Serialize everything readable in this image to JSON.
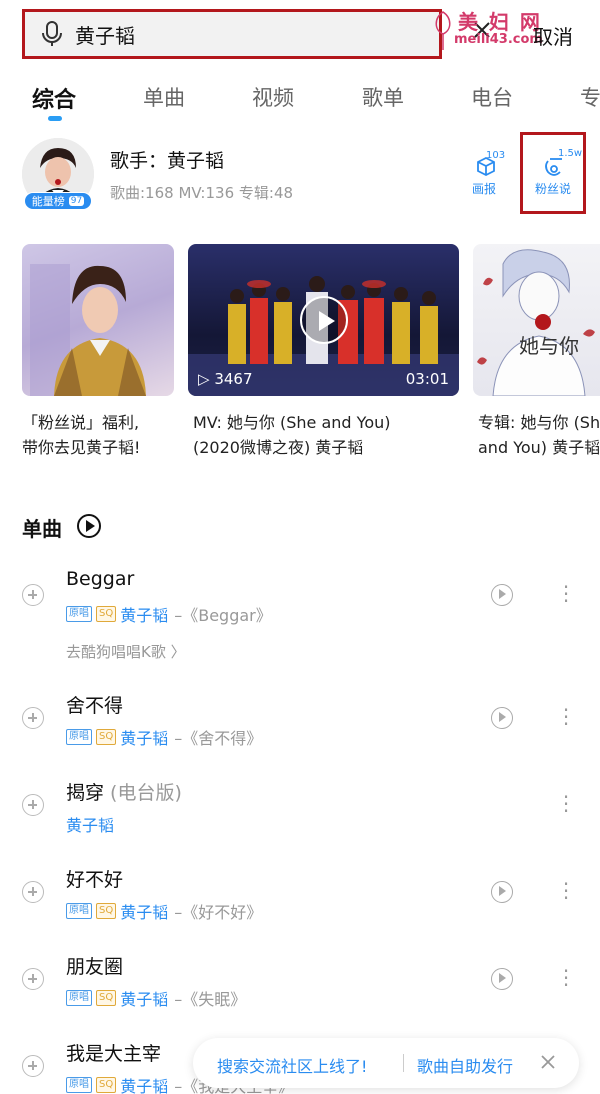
{
  "search": {
    "query": "黄子韬",
    "cancel_label": "取消"
  },
  "watermark": {
    "main": "美 妇 网",
    "sub": "meili43.com"
  },
  "tabs": [
    {
      "label": "综合"
    },
    {
      "label": "单曲"
    },
    {
      "label": "视频"
    },
    {
      "label": "歌单"
    },
    {
      "label": "电台"
    },
    {
      "label": "专"
    }
  ],
  "singer": {
    "name": "歌手：黄子韬",
    "stats": "歌曲:168  MV:136  专辑:48",
    "badge_label": "能量榜",
    "badge_level": "97",
    "poster": {
      "label": "画报",
      "count": "103"
    },
    "fans": {
      "label": "粉丝说",
      "count": "1.5w"
    }
  },
  "cards": [
    {
      "caption_1": "「粉丝说」福利,",
      "caption_2": "带你去见黄子韬!"
    },
    {
      "caption_1": "MV: 她与你 (She and You)",
      "caption_2": "(2020微博之夜) 黄子韬",
      "plays": "3467",
      "duration": "03:01"
    },
    {
      "caption_1": "专辑: 她与你 (Sh",
      "caption_2": "and You) 黄子韬",
      "art_text": "她与你"
    }
  ],
  "section": {
    "title": "单曲"
  },
  "songs": [
    {
      "title": "Beggar",
      "suffix": "",
      "tags": true,
      "artist": "黄子韬",
      "album": "–《Beggar》",
      "extra": "去酷狗唱唱K歌 〉",
      "playable": true
    },
    {
      "title": "舍不得",
      "suffix": "",
      "tags": true,
      "artist": "黄子韬",
      "album": "–《舍不得》",
      "extra": "",
      "playable": true
    },
    {
      "title": "揭穿",
      "suffix": " (电台版)",
      "tags": false,
      "artist": "黄子韬",
      "album": "",
      "extra": "",
      "playable": false
    },
    {
      "title": "好不好",
      "suffix": "",
      "tags": true,
      "artist": "黄子韬",
      "album": "–《好不好》",
      "extra": "",
      "playable": true
    },
    {
      "title": "朋友圈",
      "suffix": "",
      "tags": true,
      "artist": "黄子韬",
      "album": "–《失眠》",
      "extra": "",
      "playable": true
    },
    {
      "title": "我是大主宰",
      "suffix": "",
      "tags": true,
      "artist": "黄子韬",
      "album": "–《我是大主宰》",
      "extra": "",
      "playable": true
    }
  ],
  "tag_labels": {
    "orig": "原唱",
    "sq": "SQ"
  },
  "banner": {
    "left": "搜索交流社区上线了!",
    "right": "歌曲自助发行"
  },
  "colors": {
    "accent": "#2a8cf0",
    "highlight_box": "#b3171c"
  }
}
